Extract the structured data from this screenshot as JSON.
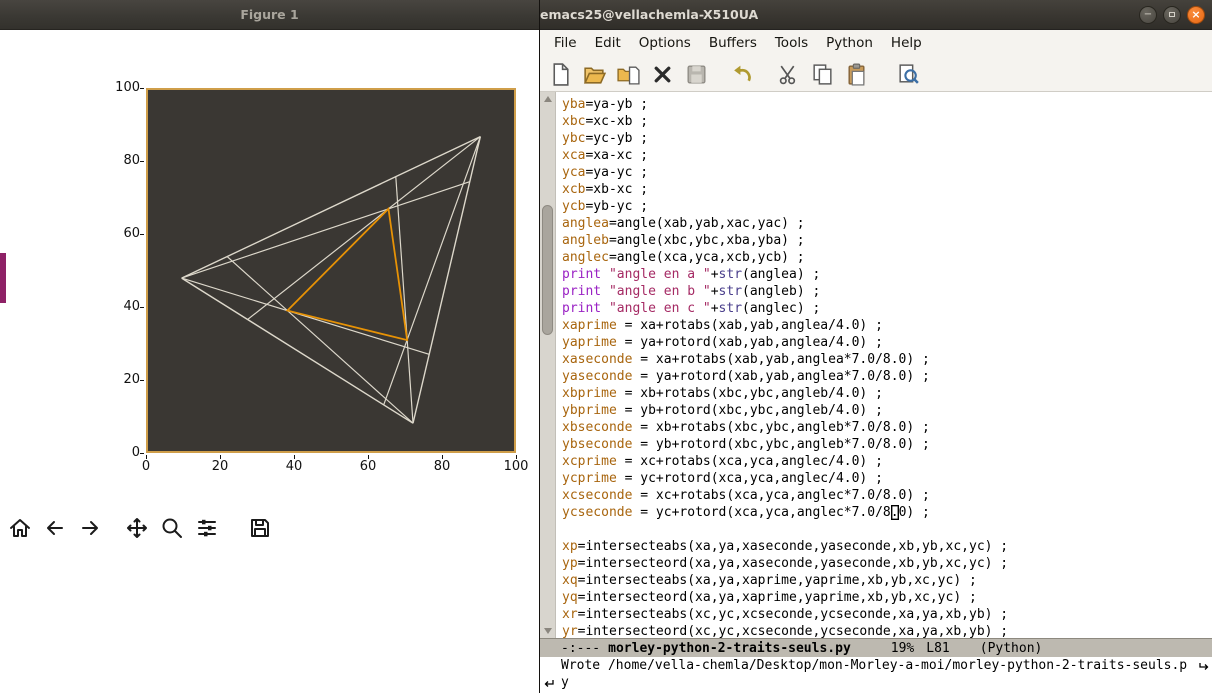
{
  "figure_window": {
    "title": "Figure 1",
    "xticks": [
      "0",
      "20",
      "40",
      "60",
      "80",
      "100"
    ],
    "yticks_top_to_bottom": [
      "100",
      "80",
      "60",
      "40",
      "20",
      "0"
    ],
    "toolbar_icons": [
      "home",
      "back",
      "forward",
      "pan",
      "zoom",
      "configure-subplots",
      "save"
    ]
  },
  "chart_data": {
    "type": "line",
    "xlim": [
      0,
      100
    ],
    "ylim": [
      0,
      100
    ],
    "xticks": [
      0,
      20,
      40,
      60,
      80,
      100
    ],
    "yticks": [
      0,
      20,
      40,
      60,
      80,
      100
    ],
    "axes_bg": "#3a3733",
    "frame_color": "#cf9e4a",
    "line_color": "#ddd8cb",
    "accent": "#e79205",
    "outer_triangle": [
      [
        90.8,
        87.1
      ],
      [
        9.2,
        47.9
      ],
      [
        72.4,
        7.7
      ]
    ],
    "cevians": [
      [
        [
          9.2,
          47.9
        ],
        [
          87.9,
          74.6
        ]
      ],
      [
        [
          9.2,
          47.9
        ],
        [
          76.8,
          26.8
        ]
      ],
      [
        [
          90.8,
          87.1
        ],
        [
          27.2,
          36.4
        ]
      ],
      [
        [
          90.8,
          87.1
        ],
        [
          64.4,
          12.8
        ]
      ],
      [
        [
          72.4,
          7.7
        ],
        [
          21.6,
          53.9
        ]
      ],
      [
        [
          72.4,
          7.7
        ],
        [
          67.7,
          76.0
        ]
      ]
    ],
    "inner_triangle": [
      [
        38.1,
        38.9
      ],
      [
        65.7,
        67.1
      ],
      [
        70.8,
        30.7
      ]
    ]
  },
  "emacs": {
    "title": "emacs25@vellachemla-X510UA",
    "window_buttons": {
      "minimize": "−",
      "maximize": "",
      "close": "×"
    },
    "menus": [
      "File",
      "Edit",
      "Options",
      "Buffers",
      "Tools",
      "Python",
      "Help"
    ],
    "toolbar_icons": [
      "new-file",
      "open-file",
      "dired",
      "kill-buffer",
      "save",
      "undo",
      "cut",
      "copy",
      "paste",
      "search"
    ],
    "faces": {
      "v": "#a8650e",
      "k": "#9a22c4",
      "s": "#a52a64",
      "b": "#483d8b",
      "d": "#000000"
    },
    "code_lines": [
      [
        [
          "v",
          "yba"
        ],
        [
          "d",
          "=ya-yb ;"
        ]
      ],
      [
        [
          "v",
          "xbc"
        ],
        [
          "d",
          "=xc-xb ;"
        ]
      ],
      [
        [
          "v",
          "ybc"
        ],
        [
          "d",
          "=yc-yb ;"
        ]
      ],
      [
        [
          "v",
          "xca"
        ],
        [
          "d",
          "=xa-xc ;"
        ]
      ],
      [
        [
          "v",
          "yca"
        ],
        [
          "d",
          "=ya-yc ;"
        ]
      ],
      [
        [
          "v",
          "xcb"
        ],
        [
          "d",
          "=xb-xc ;"
        ]
      ],
      [
        [
          "v",
          "ycb"
        ],
        [
          "d",
          "=yb-yc ;"
        ]
      ],
      [
        [
          "v",
          "anglea"
        ],
        [
          "d",
          "=angle(xab,yab,xac,yac) ;"
        ]
      ],
      [
        [
          "v",
          "angleb"
        ],
        [
          "d",
          "=angle(xbc,ybc,xba,yba) ;"
        ]
      ],
      [
        [
          "v",
          "anglec"
        ],
        [
          "d",
          "=angle(xca,yca,xcb,ycb) ;"
        ]
      ],
      [
        [
          "k",
          "print "
        ],
        [
          "s",
          "\"angle en a \""
        ],
        [
          "d",
          "+"
        ],
        [
          "b",
          "str"
        ],
        [
          "d",
          "(anglea) ;"
        ]
      ],
      [
        [
          "k",
          "print "
        ],
        [
          "s",
          "\"angle en b \""
        ],
        [
          "d",
          "+"
        ],
        [
          "b",
          "str"
        ],
        [
          "d",
          "(angleb) ;"
        ]
      ],
      [
        [
          "k",
          "print "
        ],
        [
          "s",
          "\"angle en c \""
        ],
        [
          "d",
          "+"
        ],
        [
          "b",
          "str"
        ],
        [
          "d",
          "(anglec) ;"
        ]
      ],
      [
        [
          "v",
          "xaprime"
        ],
        [
          "d",
          " = xa+rotabs(xab,yab,anglea/4.0) ;"
        ]
      ],
      [
        [
          "v",
          "yaprime"
        ],
        [
          "d",
          " = ya+rotord(xab,yab,anglea/4.0) ;"
        ]
      ],
      [
        [
          "v",
          "xaseconde"
        ],
        [
          "d",
          " = xa+rotabs(xab,yab,anglea*7.0/8.0) ;"
        ]
      ],
      [
        [
          "v",
          "yaseconde"
        ],
        [
          "d",
          " = ya+rotord(xab,yab,anglea*7.0/8.0) ;"
        ]
      ],
      [
        [
          "v",
          "xbprime"
        ],
        [
          "d",
          " = xb+rotabs(xbc,ybc,angleb/4.0) ;"
        ]
      ],
      [
        [
          "v",
          "ybprime"
        ],
        [
          "d",
          " = yb+rotord(xbc,ybc,angleb/4.0) ;"
        ]
      ],
      [
        [
          "v",
          "xbseconde"
        ],
        [
          "d",
          " = xb+rotabs(xbc,ybc,angleb*7.0/8.0) ;"
        ]
      ],
      [
        [
          "v",
          "ybseconde"
        ],
        [
          "d",
          " = yb+rotord(xbc,ybc,angleb*7.0/8.0) ;"
        ]
      ],
      [
        [
          "v",
          "xcprime"
        ],
        [
          "d",
          " = xc+rotabs(xca,yca,anglec/4.0) ;"
        ]
      ],
      [
        [
          "v",
          "ycprime"
        ],
        [
          "d",
          " = yc+rotord(xca,yca,anglec/4.0) ;"
        ]
      ],
      [
        [
          "v",
          "xcseconde"
        ],
        [
          "d",
          " = xc+rotabs(xca,yca,anglec*7.0/8.0) ;"
        ]
      ],
      [
        [
          "v",
          "ycseconde"
        ],
        [
          "d",
          " = yc+rotord(xca,yca,anglec*7.0/8"
        ],
        [
          "c",
          "."
        ],
        [
          "d",
          "0) ;"
        ]
      ],
      [],
      [
        [
          "v",
          "xp"
        ],
        [
          "d",
          "=intersecteabs(xa,ya,xaseconde,yaseconde,xb,yb,xc,yc) ;"
        ]
      ],
      [
        [
          "v",
          "yp"
        ],
        [
          "d",
          "=intersecteord(xa,ya,xaseconde,yaseconde,xb,yb,xc,yc) ;"
        ]
      ],
      [
        [
          "v",
          "xq"
        ],
        [
          "d",
          "=intersecteabs(xa,ya,xaprime,yaprime,xb,yb,xc,yc) ;"
        ]
      ],
      [
        [
          "v",
          "yq"
        ],
        [
          "d",
          "=intersecteord(xa,ya,xaprime,yaprime,xb,yb,xc,yc) ;"
        ]
      ],
      [
        [
          "v",
          "xr"
        ],
        [
          "d",
          "=intersecteabs(xc,yc,xcseconde,ycseconde,xa,ya,xb,yb) ;"
        ]
      ],
      [
        [
          "v",
          "yr"
        ],
        [
          "d",
          "=intersecteord(xc,yc,xcseconde,ycseconde,xa,ya,xb,yb) ;"
        ]
      ]
    ],
    "modeline": {
      "prefix": "-:---",
      "buffer": "morley-python-2-traits-seuls.py",
      "percent": "19%",
      "line": "L81",
      "mode": "(Python)"
    },
    "echo": {
      "line1": "Wrote /home/vella-chemla/Desktop/mon-Morley-a-moi/morley-python-2-traits-seuls.p",
      "line2": "y"
    }
  }
}
